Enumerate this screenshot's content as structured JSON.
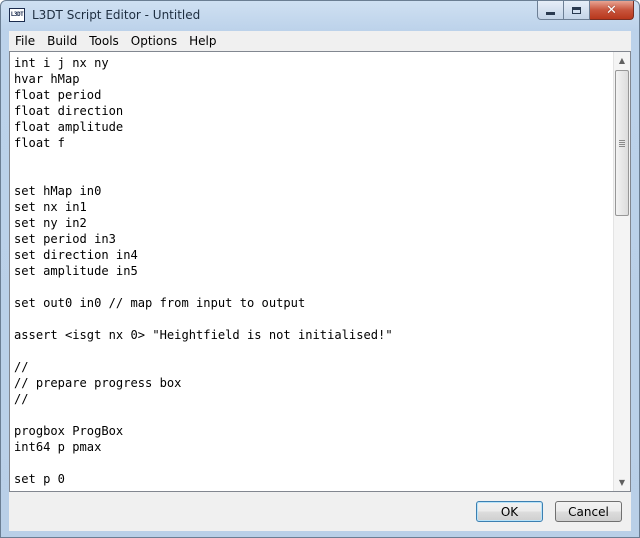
{
  "window": {
    "title": "L3DT Script Editor - Untitled",
    "app_icon_text": "L3DT"
  },
  "menubar": {
    "items": [
      "File",
      "Build",
      "Tools",
      "Options",
      "Help"
    ]
  },
  "editor": {
    "lines": [
      "int i j nx ny",
      "hvar hMap",
      "float period",
      "float direction",
      "float amplitude",
      "float f",
      "",
      "",
      "set hMap in0",
      "set nx in1",
      "set ny in2",
      "set period in3",
      "set direction in4",
      "set amplitude in5",
      "",
      "set out0 in0 // map from input to output",
      "",
      "assert <isgt nx 0> \"Heightfield is not initialised!\"",
      "",
      "//",
      "// prepare progress box",
      "//",
      "",
      "progbox ProgBox",
      "int64 p pmax",
      "",
      "set p 0"
    ]
  },
  "buttons": {
    "ok_label": "OK",
    "cancel_label": "Cancel"
  },
  "icons": {
    "up_arrow": "▲",
    "down_arrow": "▼",
    "close": "✕"
  }
}
